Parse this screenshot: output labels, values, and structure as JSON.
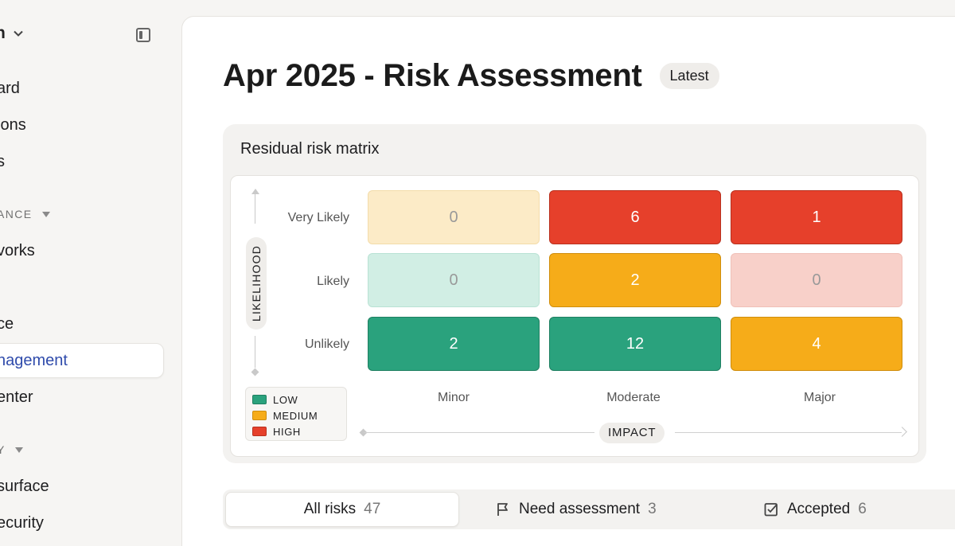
{
  "sidebar": {
    "workspace": "n",
    "items": [
      {
        "label": "ard"
      },
      {
        "label": "ions"
      },
      {
        "label": "s"
      },
      {
        "label": "vorks"
      },
      {
        "label": "ce"
      },
      {
        "label": "nagement"
      },
      {
        "label": "enter"
      },
      {
        "label": "surface"
      },
      {
        "label": "ecurity"
      }
    ],
    "sections": [
      {
        "label": "ANCE"
      },
      {
        "label": "Y"
      }
    ]
  },
  "header": {
    "title": "Apr 2025 - Risk Assessment",
    "badge": "Latest"
  },
  "matrix": {
    "title": "Residual risk matrix",
    "y_axis_label": "LIKELIHOOD",
    "x_axis_label": "IMPACT",
    "rows": [
      "Very Likely",
      "Likely",
      "Unlikely"
    ],
    "columns": [
      "Minor",
      "Moderate",
      "Major"
    ],
    "cells": [
      [
        {
          "value": "0",
          "level": "medium-empty"
        },
        {
          "value": "6",
          "level": "high"
        },
        {
          "value": "1",
          "level": "high"
        }
      ],
      [
        {
          "value": "0",
          "level": "low-empty"
        },
        {
          "value": "2",
          "level": "medium"
        },
        {
          "value": "0",
          "level": "high-empty"
        }
      ],
      [
        {
          "value": "2",
          "level": "low"
        },
        {
          "value": "12",
          "level": "low"
        },
        {
          "value": "4",
          "level": "medium"
        }
      ]
    ],
    "legend": [
      {
        "label": "LOW",
        "color": "#2aa27d"
      },
      {
        "label": "MEDIUM",
        "color": "#f6ac19"
      },
      {
        "label": "HIGH",
        "color": "#e6402b"
      }
    ]
  },
  "tabs": [
    {
      "label": "All risks",
      "count": "47",
      "icon": "none"
    },
    {
      "label": "Need assessment",
      "count": "3",
      "icon": "flag-icon"
    },
    {
      "label": "Accepted",
      "count": "6",
      "icon": "checkbox-icon"
    }
  ]
}
